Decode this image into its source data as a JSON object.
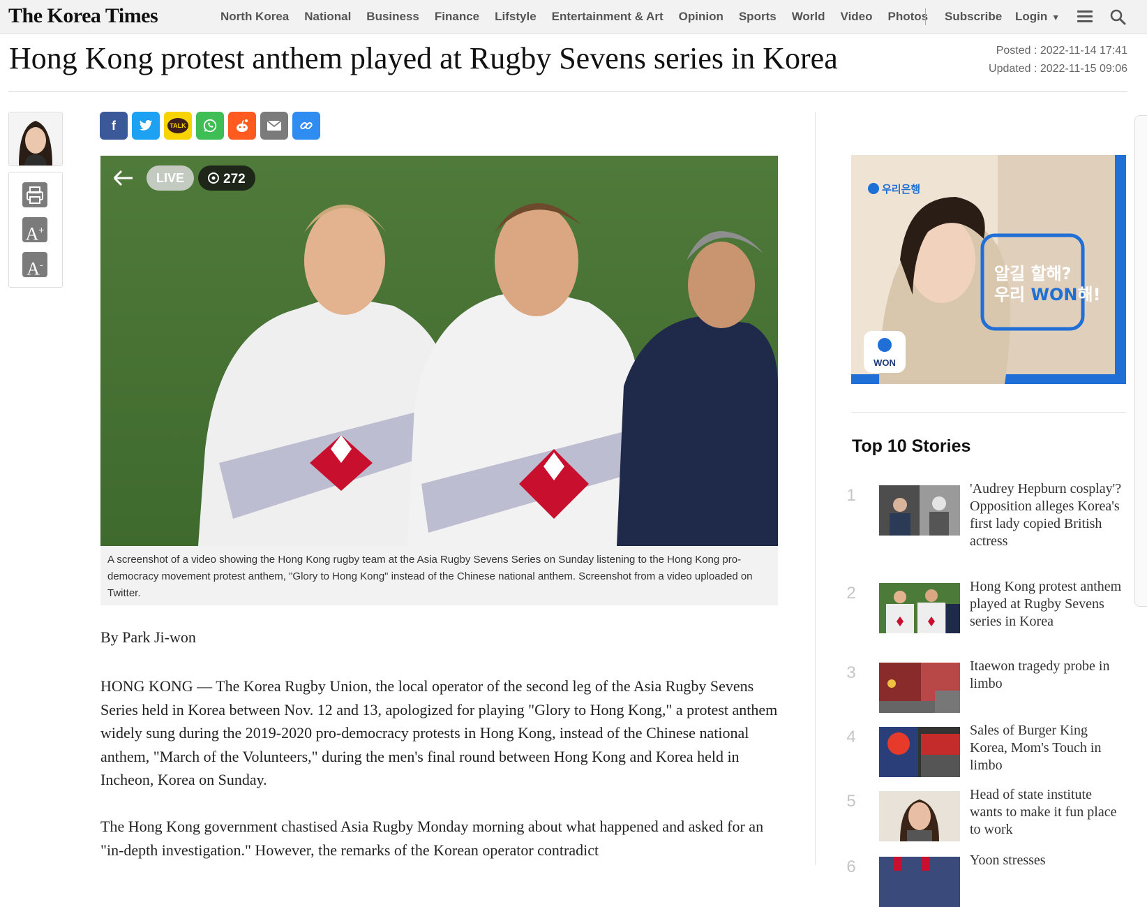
{
  "site": {
    "logo": "The Korea Times"
  },
  "nav": {
    "items": [
      "North Korea",
      "National",
      "Business",
      "Finance",
      "Lifstyle",
      "Entertainment & Art",
      "Opinion",
      "Sports",
      "World",
      "Video",
      "Photos"
    ],
    "subscribe": "Subscribe",
    "login": "Login"
  },
  "article": {
    "headline": "Hong Kong protest anthem played at Rugby Sevens series in Korea",
    "posted": "Posted : 2022-11-14 17:41",
    "updated": "Updated : 2022-11-15 09:06",
    "photo_overlay": {
      "live": "LIVE",
      "views": "272"
    },
    "caption": "A screenshot of a video showing the Hong Kong rugby team at the Asia Rugby Sevens Series on Sunday listening to the Hong Kong pro-democracy movement protest anthem, \"Glory to Hong Kong\" instead of the Chinese national anthem. Screenshot from a video uploaded on Twitter.",
    "byline": "By Park Ji-won",
    "paragraphs": [
      "HONG KONG — The Korea Rugby Union, the local operator of the second leg of the Asia Rugby Sevens Series held in Korea between Nov. 12 and 13, apologized for playing \"Glory to Hong Kong,\" a protest anthem widely sung during the 2019-2020 pro-democracy protests in Hong Kong, instead of the Chinese national anthem, \"March of the Volunteers,\" during the men's final round between Hong Kong and Korea held in Incheon, Korea on Sunday.",
      "The Hong Kong government chastised Asia Rugby Monday morning about what happened and asked for an \"in-depth investigation.\" However, the remarks of the Korean operator contradict"
    ]
  },
  "tools": {
    "print": "print-icon",
    "font_up": "A+",
    "font_down": "A-"
  },
  "share": [
    {
      "name": "facebook",
      "glyph": "f",
      "color": "#3b5998"
    },
    {
      "name": "twitter",
      "glyph": "t",
      "color": "#1da1f2"
    },
    {
      "name": "kakaotalk",
      "glyph": "TALK",
      "color": "#f7d300"
    },
    {
      "name": "whatsapp",
      "glyph": "w",
      "color": "#3ebe55"
    },
    {
      "name": "reddit",
      "glyph": "r",
      "color": "#ff5a1f"
    },
    {
      "name": "email",
      "glyph": "✉",
      "color": "#7b7b7b"
    },
    {
      "name": "link",
      "glyph": "🔗",
      "color": "#2f8cf0"
    }
  ],
  "ad": {
    "bank": "우리은행",
    "line1": "알길 할해?",
    "line2": "우리 WON해!",
    "badge": "WON"
  },
  "sidebar": {
    "title": "Top 10 Stories",
    "stories": [
      {
        "num": "1",
        "title": "'Audrey Hepburn cosplay'? Opposition alleges Korea's first lady copied British actress"
      },
      {
        "num": "2",
        "title": "Hong Kong protest anthem played at Rugby Sevens series in Korea"
      },
      {
        "num": "3",
        "title": "Itaewon tragedy probe in limbo"
      },
      {
        "num": "4",
        "title": "Sales of Burger King Korea, Mom's Touch in limbo"
      },
      {
        "num": "5",
        "title": "Head of state institute wants to make it fun place to work"
      },
      {
        "num": "6",
        "title": "Yoon stresses"
      }
    ]
  }
}
